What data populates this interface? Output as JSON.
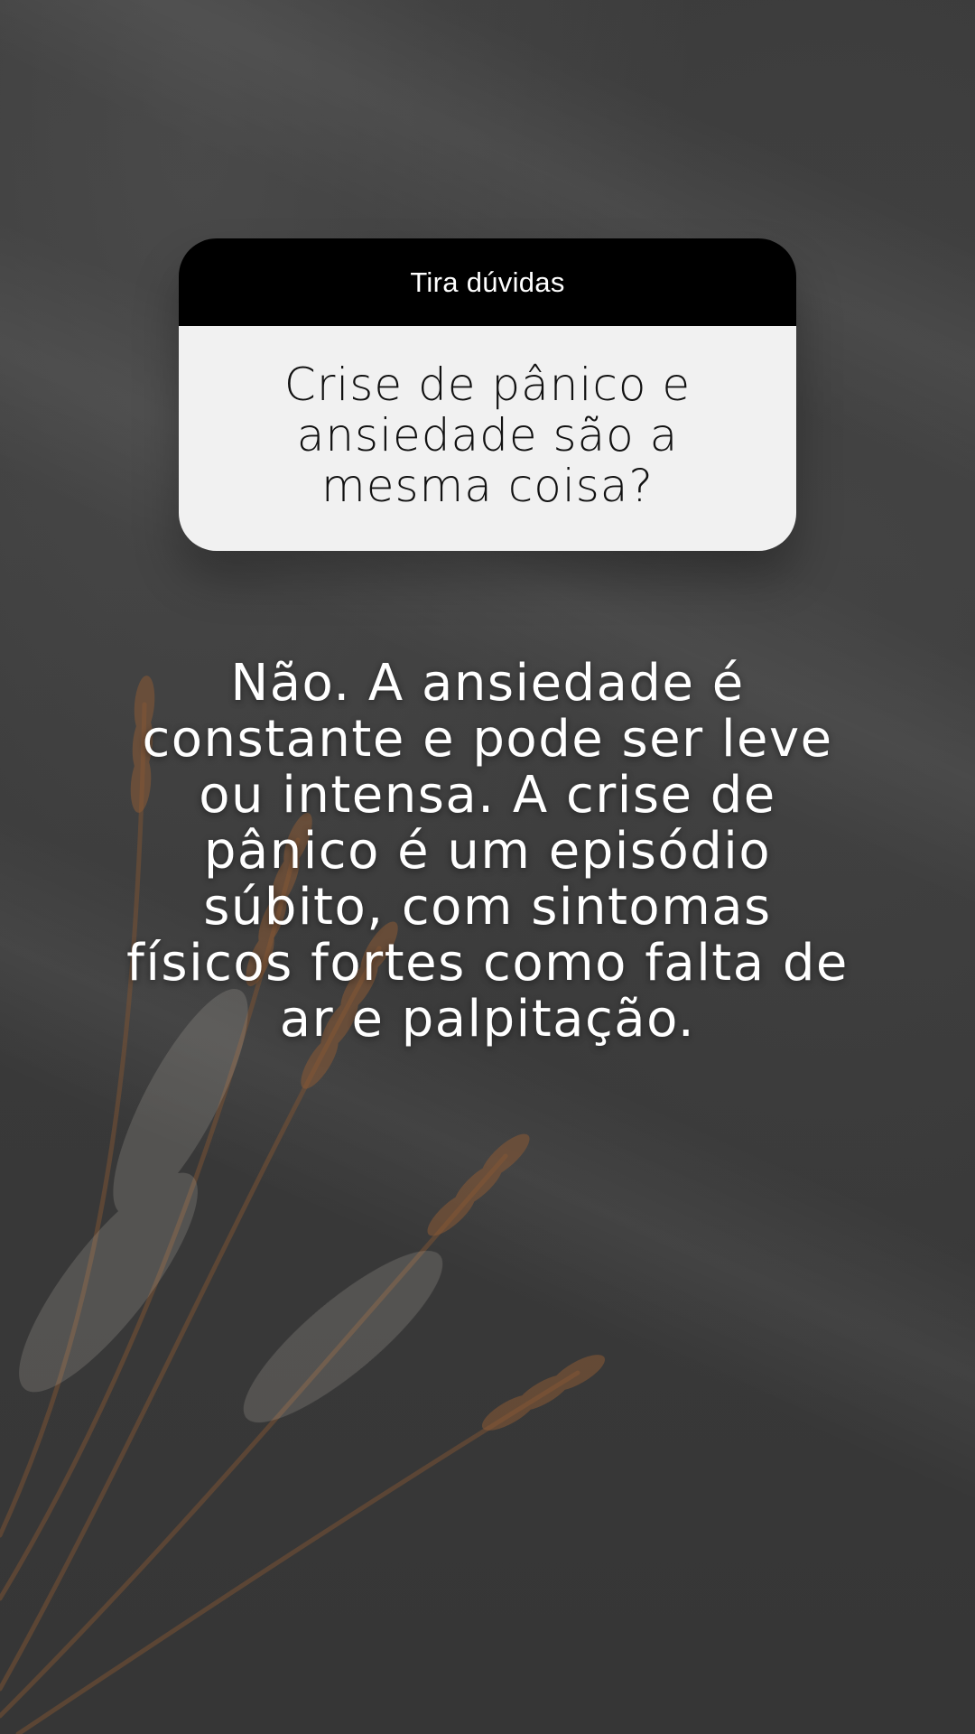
{
  "question_card": {
    "header_label": "Tira dúvidas",
    "question_text": "Crise de pânico e ansiedade são a mesma coisa?"
  },
  "answer": {
    "text": "Não. A ansiedade é constante e pode ser leve ou intensa. A crise de pânico é um episódio súbito, com sintomas físicos fortes como falta de ar e palpitação."
  },
  "colors": {
    "background": "#3a3a3a",
    "card_header": "#000000",
    "card_body": "#f1f1f1",
    "answer_text": "#ffffff",
    "wheat": "#8a5a36"
  }
}
